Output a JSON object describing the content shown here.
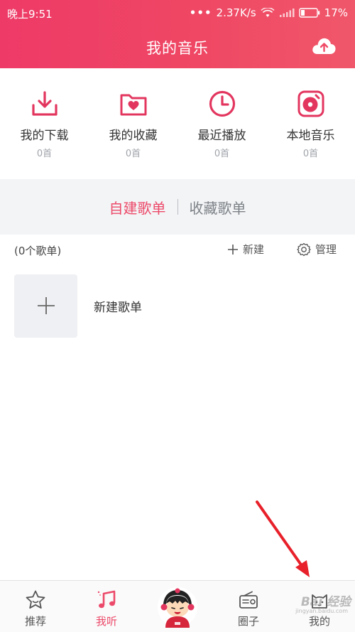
{
  "status_bar": {
    "time": "晚上9:51",
    "dots": "•••",
    "speed": "2.37K/s",
    "battery": "17%"
  },
  "header": {
    "title": "我的音乐",
    "upload_icon": "cloud-upload-icon"
  },
  "quick_access": [
    {
      "label": "我的下载",
      "count": "0首",
      "icon": "download-icon"
    },
    {
      "label": "我的收藏",
      "count": "0首",
      "icon": "favorite-folder-icon"
    },
    {
      "label": "最近播放",
      "count": "0首",
      "icon": "clock-icon"
    },
    {
      "label": "本地音乐",
      "count": "0首",
      "icon": "vinyl-icon"
    }
  ],
  "tabs": {
    "self_created": "自建歌单",
    "favorited": "收藏歌单"
  },
  "toolbar": {
    "playlist_count": "(0个歌单)",
    "new_label": "新建",
    "manage_label": "管理"
  },
  "new_playlist": {
    "label": "新建歌单"
  },
  "bottom_nav": [
    {
      "label": "推荐",
      "icon": "star-icon"
    },
    {
      "label": "我听",
      "icon": "music-note-icon"
    },
    {
      "label": "",
      "icon": "avatar-icon"
    },
    {
      "label": "圈子",
      "icon": "radio-icon"
    },
    {
      "label": "我的",
      "icon": "cat-icon"
    }
  ],
  "watermark": {
    "text": "Bai 经验",
    "sub": "jingyan.baidu.com"
  },
  "colors": {
    "accent": "#ec4a6a",
    "header_gradient_start": "#ee3a67",
    "header_gradient_end": "#f0576a",
    "annotation_arrow": "#e8202a"
  }
}
